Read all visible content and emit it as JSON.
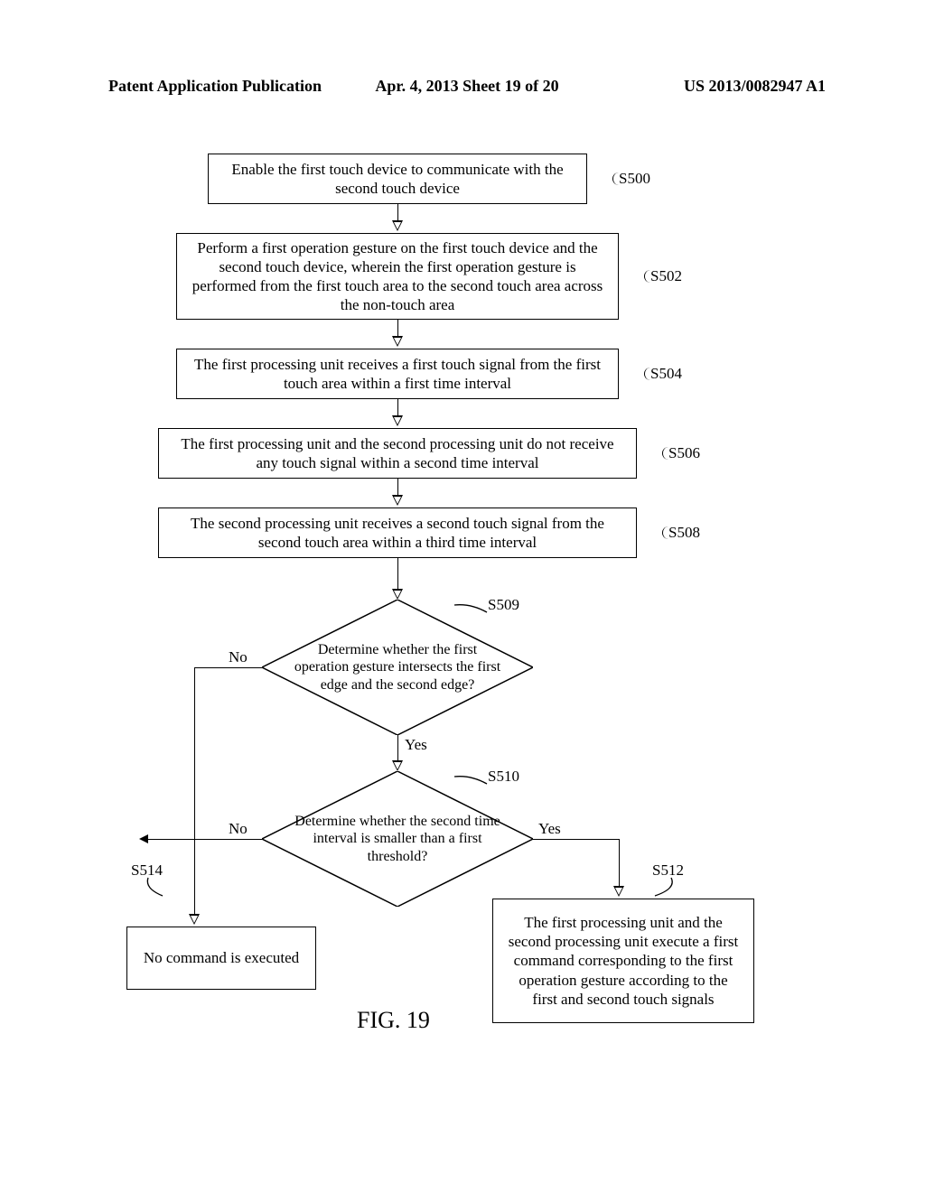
{
  "header": {
    "left": "Patent Application Publication",
    "center": "Apr. 4, 2013  Sheet 19 of 20",
    "right": "US 2013/0082947 A1"
  },
  "steps": {
    "s500": {
      "ref": "S500",
      "text": "Enable the first touch device to communicate with the second touch device"
    },
    "s502": {
      "ref": "S502",
      "text": "Perform a first operation gesture on the first touch device and the second touch device, wherein the first operation gesture is performed from the first touch area to the second touch area across the non-touch area"
    },
    "s504": {
      "ref": "S504",
      "text": "The first processing unit receives a first touch signal from the first touch area within a first time interval"
    },
    "s506": {
      "ref": "S506",
      "text": "The first processing unit and the second processing unit do not receive any touch signal within a second time interval"
    },
    "s508": {
      "ref": "S508",
      "text": "The second processing unit receives a second touch signal from the second touch area within a third time interval"
    },
    "s509": {
      "ref": "S509",
      "text": "Determine whether the first operation gesture intersects the first edge and the second edge?"
    },
    "s510": {
      "ref": "S510",
      "text": "Determine whether the second time interval is smaller than a first threshold?"
    },
    "s512": {
      "ref": "S512",
      "text": "The first processing unit and the second processing unit execute a first command corresponding to the first operation gesture according to the first and second touch signals"
    },
    "s514": {
      "ref": "S514",
      "text": "No command is executed"
    }
  },
  "labels": {
    "yes": "Yes",
    "no": "No"
  },
  "figure_caption": "FIG. 19"
}
